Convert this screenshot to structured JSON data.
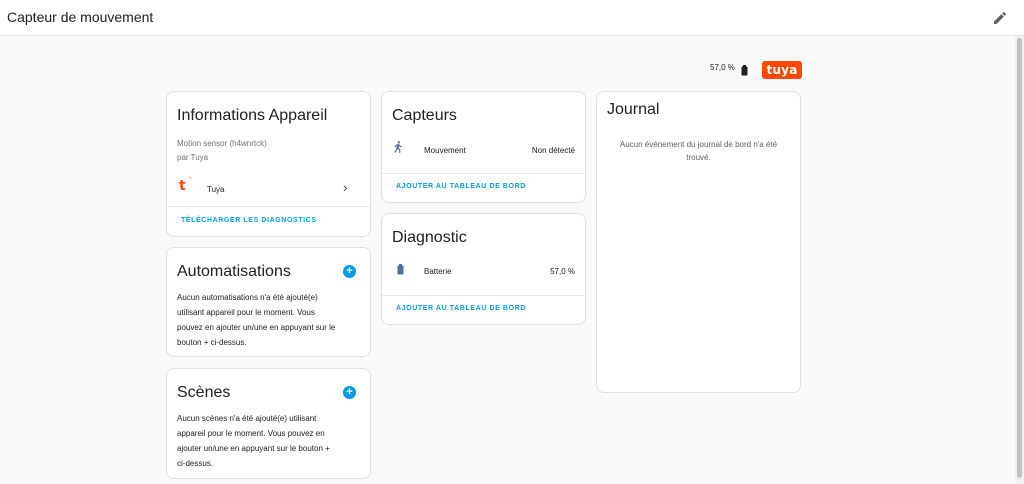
{
  "header": {
    "title": "Capteur de mouvement"
  },
  "status": {
    "battery": "57,0 %",
    "brand": "tuya"
  },
  "device_info": {
    "title": "Informations Appareil",
    "model": "Motion sensor (h4wnrtck)",
    "manufacturer": "par Tuya",
    "integration": "Tuya",
    "action": "TÉLÉCHARGER LES DIAGNOSTICS"
  },
  "automations": {
    "title": "Automatisations",
    "lines": [
      "Aucun automatisations n'a été ajouté(e)",
      "utilisant appareil pour le moment. Vous",
      "pouvez en ajouter un/une en appuyant sur le",
      "bouton + ci-dessus."
    ]
  },
  "scenes": {
    "title": "Scènes",
    "lines": [
      "Aucun scènes n'a été ajouté(e) utilisant",
      "appareil pour le moment. Vous pouvez en",
      "ajouter un/une en appuyant sur le bouton +",
      "ci-dessus."
    ]
  },
  "sensors": {
    "title": "Capteurs",
    "entity_name": "Mouvement",
    "entity_state": "Non détecté",
    "action": "AJOUTER AU TABLEAU DE BORD"
  },
  "diagnostic": {
    "title": "Diagnostic",
    "entity_name": "Batterie",
    "entity_state": "57,0 %",
    "action": "AJOUTER AU TABLEAU DE BORD"
  },
  "logbook": {
    "title": "Journal",
    "line1": "Aucun événement du journal de bord n'a été",
    "line2": "trouvé."
  },
  "colors": {
    "accent": "#039be5",
    "tuya": "#ff4800"
  }
}
